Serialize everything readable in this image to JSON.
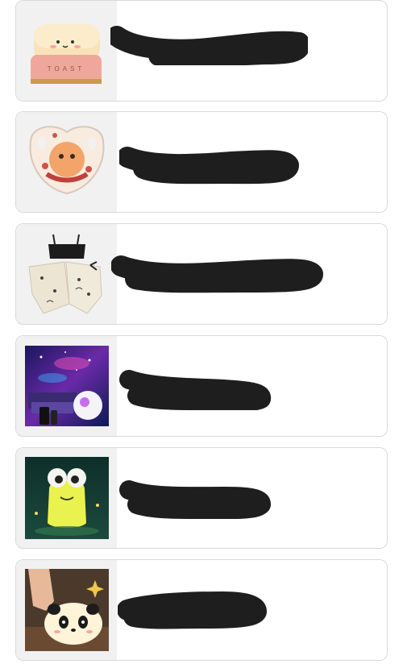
{
  "products": [
    {
      "title": "",
      "thumbnail_icon": "toast-lamp-image",
      "thumb_text": "TOAST"
    },
    {
      "title": "",
      "thumbnail_icon": "pacifier-image"
    },
    {
      "title": "",
      "thumbnail_icon": "pajama-set-image"
    },
    {
      "title": "",
      "thumbnail_icon": "galaxy-projector-image"
    },
    {
      "title": "",
      "thumbnail_icon": "frog-lamp-image"
    },
    {
      "title": "",
      "thumbnail_icon": "panda-lamp-image"
    }
  ],
  "colors": {
    "title_teal": "#17a197",
    "redaction": "#1e1e1e",
    "card_border": "#d9d9d9"
  }
}
